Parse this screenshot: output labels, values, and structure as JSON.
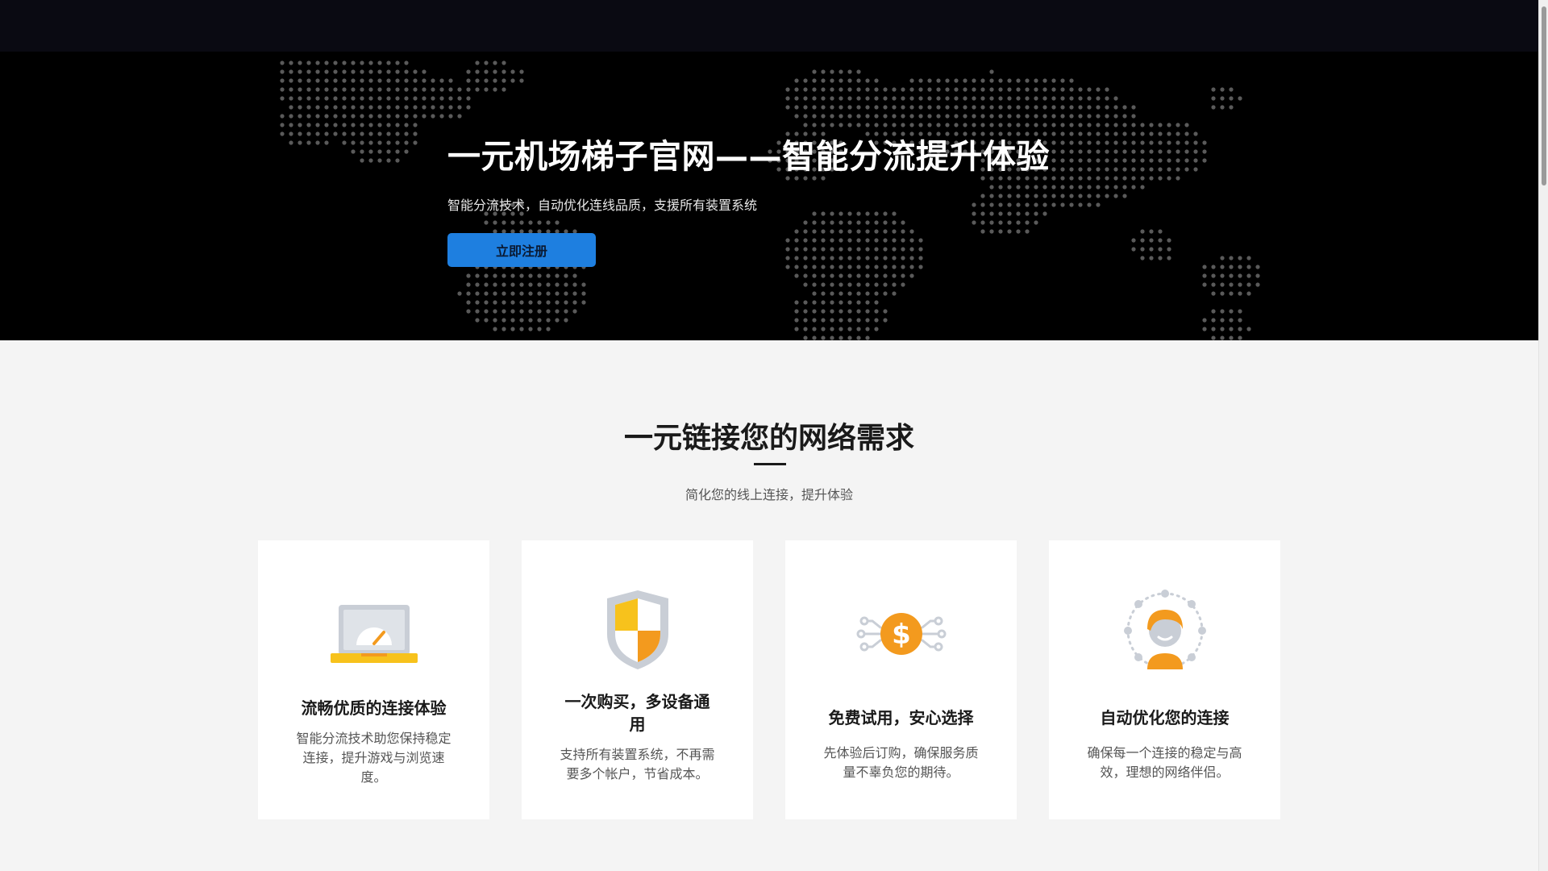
{
  "hero": {
    "title": "一元机场梯子官网——智能分流提升体验",
    "subtitle": "智能分流技术，自动优化连线品质，支援所有装置系统",
    "cta_label": "立即注册"
  },
  "features": {
    "title": "一元链接您的网络需求",
    "subtitle": "简化您的线上连接，提升体验",
    "cards": [
      {
        "icon": "speedometer-laptop-icon",
        "title": "流畅优质的连接体验",
        "description": "智能分流技术助您保持稳定连接，提升游戏与浏览速度。"
      },
      {
        "icon": "shield-icon",
        "title": "一次购买，多设备通用",
        "description": "支持所有装置系统，不再需要多个帐户，节省成本。"
      },
      {
        "icon": "dollar-network-icon",
        "title": "免费试用，安心选择",
        "description": "先体验后订购，确保服务质量不辜负您的期待。"
      },
      {
        "icon": "user-network-icon",
        "title": "自动优化您的连接",
        "description": "确保每一个连接的稳定与高效，理想的网络伴侣。"
      }
    ]
  },
  "colors": {
    "accent": "#1e7fe0",
    "icon_orange": "#f39a1e",
    "icon_yellow": "#f7c21c",
    "icon_gray": "#c9ced6"
  }
}
